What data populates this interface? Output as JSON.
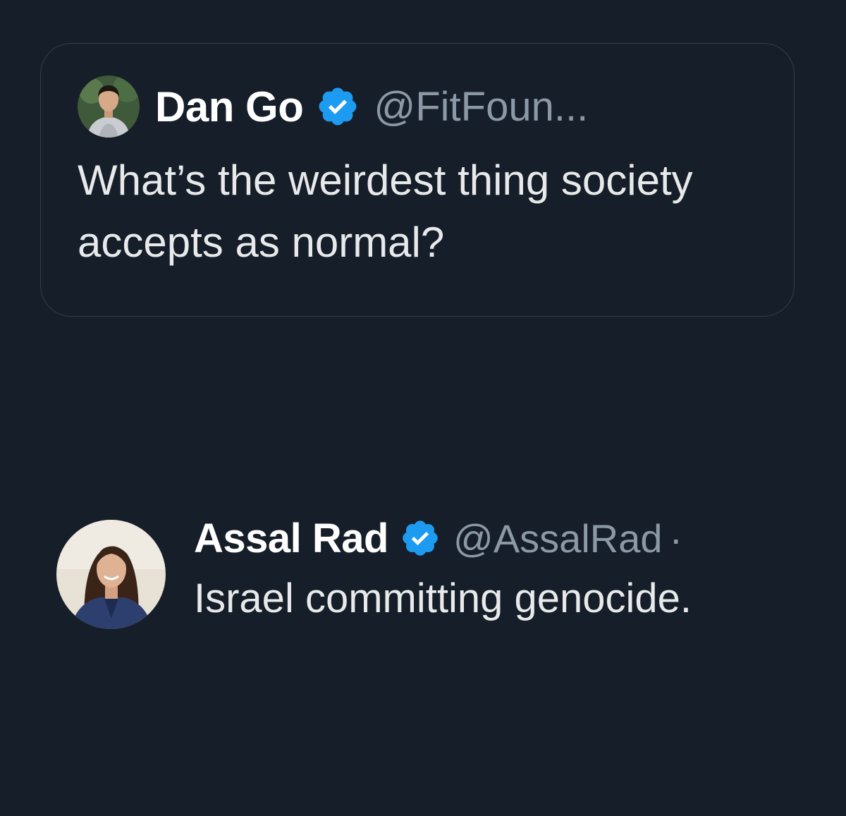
{
  "quoted_tweet": {
    "author_name": "Dan Go",
    "handle": "@FitFoun...",
    "verified_icon": "verified-badge-icon",
    "text": "What’s the weirdest thing society accepts as normal?"
  },
  "reply_tweet": {
    "author_name": "Assal Rad",
    "handle": "@AssalRad",
    "separator": "·",
    "verified_icon": "verified-badge-icon",
    "text": "Israel committing genocide."
  },
  "colors": {
    "background": "#161e29",
    "card_border": "#353d47",
    "primary_text": "#e7e9ea",
    "secondary_text": "#8b98a5",
    "verified_blue": "#1d9bf0"
  }
}
